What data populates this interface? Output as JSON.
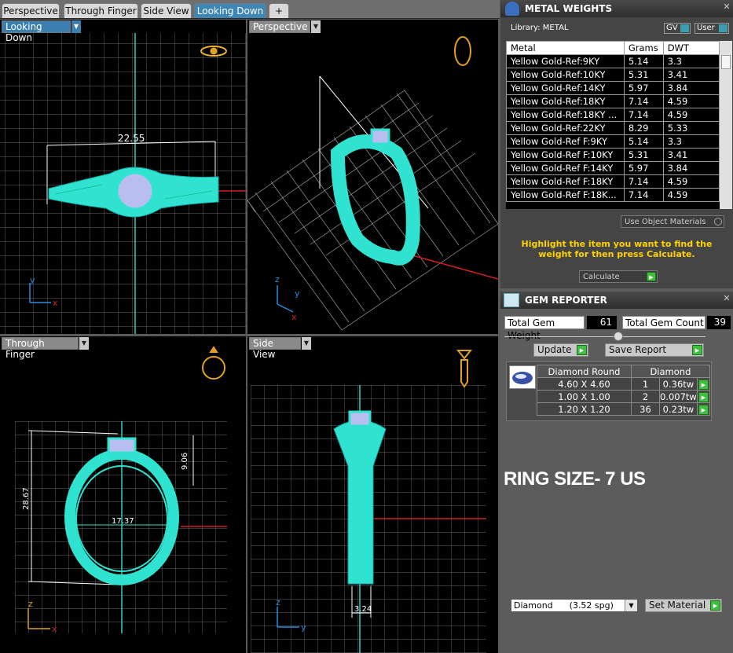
{
  "tabs": [
    "Perspective",
    "Through Finger",
    "Side View",
    "Looking Down"
  ],
  "tab_add": "+",
  "viewports": {
    "looking_down": {
      "label": "Looking Down",
      "dimension": "22.55"
    },
    "perspective": {
      "label": "Perspective"
    },
    "through_finger": {
      "label": "Through Finger",
      "dim_height": "28.67",
      "dim_width": "17.37",
      "dim_top": "9.06"
    },
    "side_view": {
      "label": "Side View",
      "dimension": "3.24"
    }
  },
  "axes": {
    "x": "x",
    "y": "y",
    "z": "z"
  },
  "metal_weights": {
    "title": "METAL WEIGHTS",
    "library_label": "Library: METAL",
    "gv_label": "GV",
    "user_label": "User",
    "columns": [
      "Metal",
      "Grams",
      "DWT"
    ],
    "rows": [
      [
        "Yellow Gold-Ref:9KY",
        "5.14",
        "3.3"
      ],
      [
        "Yellow Gold-Ref:10KY",
        "5.31",
        "3.41"
      ],
      [
        "Yellow Gold-Ref:14KY",
        "5.97",
        "3.84"
      ],
      [
        "Yellow Gold-Ref:18KY",
        "7.14",
        "4.59"
      ],
      [
        "Yellow Gold-Ref:18KY ...",
        "7.14",
        "4.59"
      ],
      [
        "Yellow Gold-Ref:22KY",
        "8.29",
        "5.33"
      ],
      [
        "Yellow Gold-Ref F:9KY",
        "5.14",
        "3.3"
      ],
      [
        "Yellow Gold-Ref F:10KY",
        "5.31",
        "3.41"
      ],
      [
        "Yellow Gold-Ref F:14KY",
        "5.97",
        "3.84"
      ],
      [
        "Yellow Gold-Ref F:18KY",
        "7.14",
        "4.59"
      ],
      [
        "Yellow Gold-Ref F:18K...",
        "7.14",
        "4.59"
      ]
    ],
    "use_object_materials": "Use Object Materials",
    "hint": "Highlight the item you want to find the weight for then press Calculate.",
    "calculate": "Calculate"
  },
  "gem_reporter": {
    "title": "GEM REPORTER",
    "total_weight_label": "Total Gem Weight",
    "total_weight": "61",
    "total_count_label": "Total Gem Count",
    "total_count": "39",
    "update": "Update",
    "save_report": "Save Report",
    "columns": [
      "Diamond Round",
      "Diamond"
    ],
    "rows": [
      [
        "4.60 X 4.60",
        "1",
        "0.36tw"
      ],
      [
        "1.00 X 1.00",
        "2",
        "0.007tw"
      ],
      [
        "1.20 X 1.20",
        "36",
        "0.23tw"
      ]
    ],
    "ring_size": "RING SIZE- 7 US",
    "material_select": "Diamond      (3.52 spg)",
    "set_material": "Set Material"
  },
  "colors": {
    "ring": "#2fe3d0",
    "grid": "#9a9a9a",
    "accent": "#3f86b4",
    "hint": "#ffd200"
  }
}
